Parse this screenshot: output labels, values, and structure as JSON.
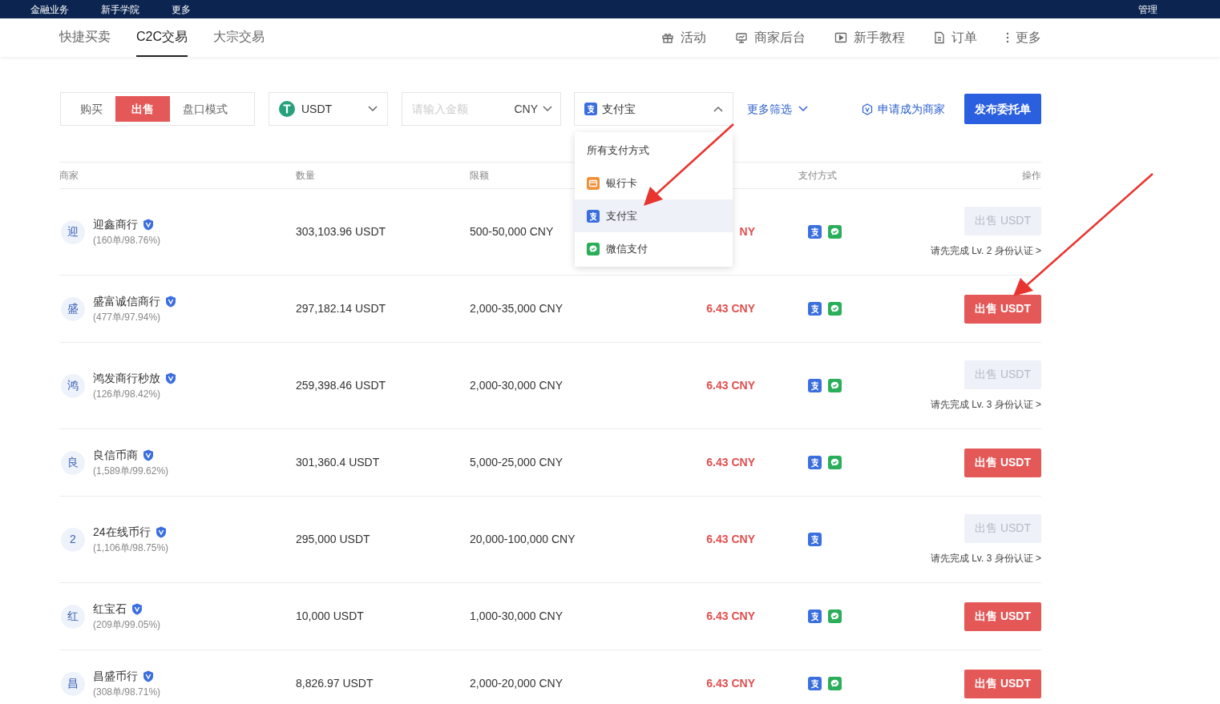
{
  "top_nav": {
    "left_items": [
      "金融业务",
      "新手学院",
      "更多"
    ],
    "right_items": [
      "管理"
    ]
  },
  "tabs": [
    {
      "label": "快捷买卖",
      "selected": false
    },
    {
      "label": "C2C交易",
      "selected": true
    },
    {
      "label": "大宗交易",
      "selected": false
    }
  ],
  "header_links": [
    "活动",
    "商家后台",
    "新手教程",
    "订单",
    "更多"
  ],
  "filters": {
    "side": [
      {
        "label": "购买",
        "selected": false
      },
      {
        "label": "出售",
        "selected": true
      },
      {
        "label": "盘口模式",
        "selected": false
      }
    ],
    "coin": "USDT",
    "amount_placeholder": "请输入金额",
    "currency": "CNY",
    "payment": "支付宝",
    "more_filters": "更多筛选"
  },
  "apply_merchant": "申请成为商家",
  "publish": "发布委托单",
  "payment_menu": {
    "items": [
      {
        "label": "所有支付方式",
        "kind": "all",
        "selected": false
      },
      {
        "label": "银行卡",
        "kind": "bank",
        "selected": false
      },
      {
        "label": "支付宝",
        "kind": "alipay",
        "selected": true
      },
      {
        "label": "微信支付",
        "kind": "wechat",
        "selected": false
      }
    ]
  },
  "table": {
    "columns": [
      "商家",
      "数量",
      "限额",
      "支付方式",
      "操作"
    ],
    "rows": [
      {
        "avatar": "迎",
        "name": "迎鑫商行",
        "stats": "(160单/98.76%)",
        "quantity": "303,103.96 USDT",
        "limit": "500-50,000 CNY",
        "price": "NY",
        "alipay": true,
        "wechat": true,
        "action": {
          "label": "出售 USDT",
          "disabled": true
        },
        "note": "请先完成 Lv. 2 身份认证 >"
      },
      {
        "avatar": "盛",
        "name": "盛富诚信商行",
        "stats": "(477单/97.94%)",
        "quantity": "297,182.14 USDT",
        "limit": "2,000-35,000 CNY",
        "price": "6.43 CNY",
        "alipay": true,
        "wechat": true,
        "action": {
          "label": "出售 USDT",
          "disabled": false
        }
      },
      {
        "avatar": "鸿",
        "name": "鸿发商行秒放",
        "stats": "(126单/98.42%)",
        "quantity": "259,398.46 USDT",
        "limit": "2,000-30,000 CNY",
        "price": "6.43 CNY",
        "alipay": true,
        "wechat": true,
        "action": {
          "label": "出售 USDT",
          "disabled": true
        },
        "note": "请先完成 Lv. 3 身份认证 >"
      },
      {
        "avatar": "良",
        "name": "良信币商",
        "stats": "(1,589单/99.62%)",
        "quantity": "301,360.4 USDT",
        "limit": "5,000-25,000 CNY",
        "price": "6.43 CNY",
        "alipay": true,
        "wechat": true,
        "action": {
          "label": "出售 USDT",
          "disabled": false
        }
      },
      {
        "avatar": "2",
        "name": "24在线币行",
        "stats": "(1,106单/98.75%)",
        "quantity": "295,000 USDT",
        "limit": "20,000-100,000 CNY",
        "price": "6.43 CNY",
        "alipay": true,
        "wechat": false,
        "action": {
          "label": "出售 USDT",
          "disabled": true
        },
        "note": "请先完成 Lv. 3 身份认证 >"
      },
      {
        "avatar": "红",
        "name": "红宝石",
        "stats": "(209单/99.05%)",
        "quantity": "10,000 USDT",
        "limit": "1,000-30,000 CNY",
        "price": "6.43 CNY",
        "alipay": true,
        "wechat": true,
        "action": {
          "label": "出售 USDT",
          "disabled": false
        }
      },
      {
        "avatar": "昌",
        "name": "昌盛币行",
        "stats": "(308单/98.71%)",
        "quantity": "8,826.97 USDT",
        "limit": "2,000-20,000 CNY",
        "price": "6.43 CNY",
        "alipay": true,
        "wechat": true,
        "action": {
          "label": "出售 USDT",
          "disabled": false
        }
      }
    ]
  }
}
